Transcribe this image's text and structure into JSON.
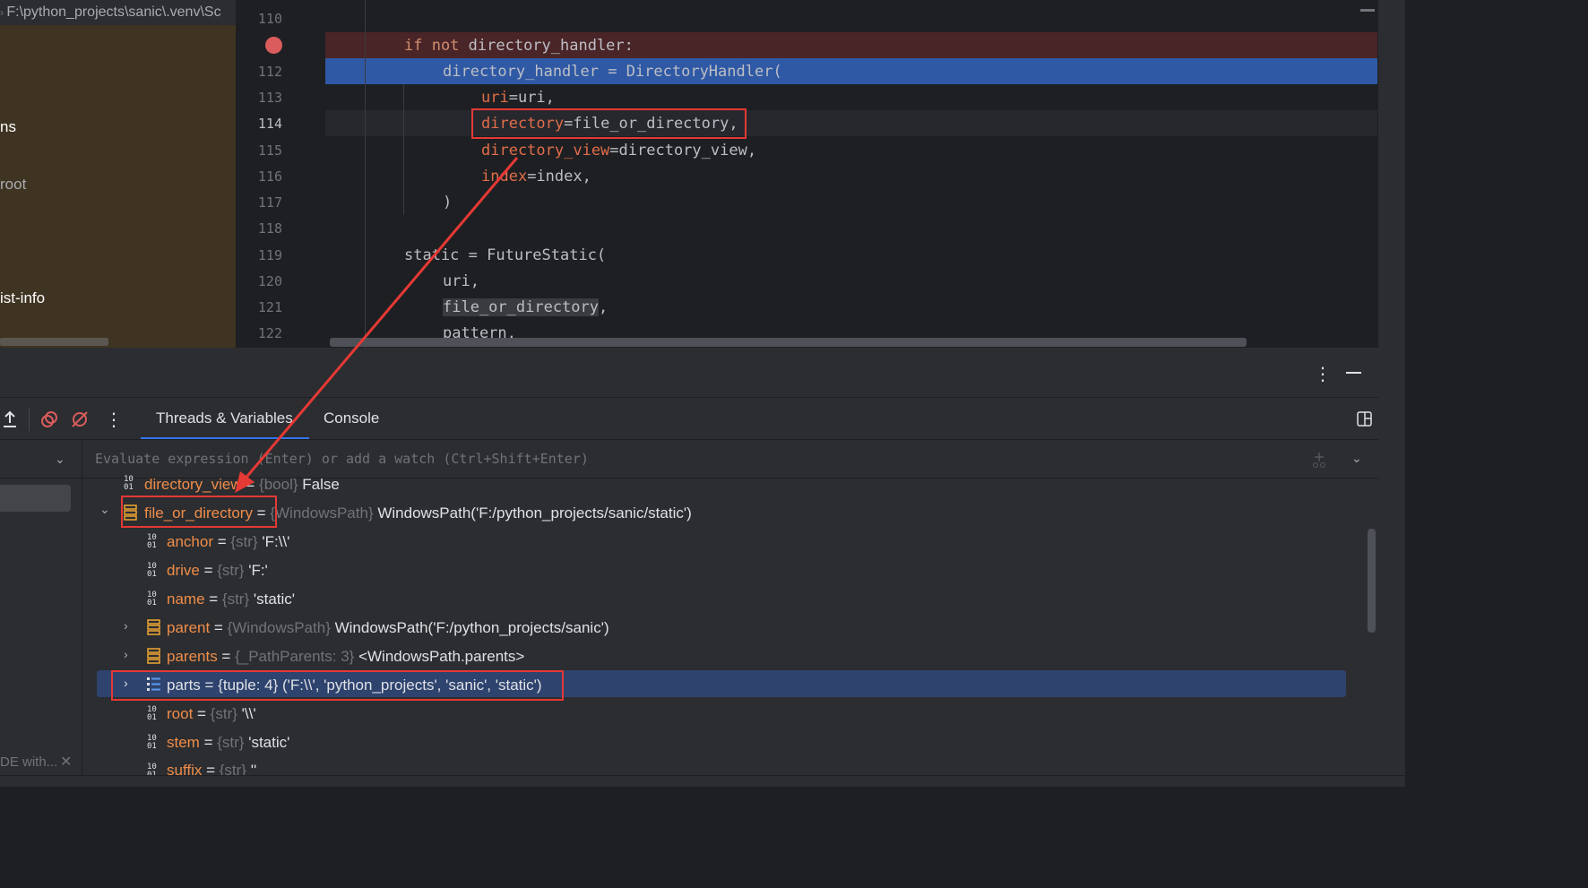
{
  "project": {
    "path": "F:\\python_projects\\sanic\\.venv\\Sc",
    "items": [
      "ns",
      "root",
      "ist-info"
    ]
  },
  "editor": {
    "lines": [
      {
        "n": "110"
      },
      {
        "n": ""
      },
      {
        "n": "112"
      },
      {
        "n": "113"
      },
      {
        "n": "114"
      },
      {
        "n": "115"
      },
      {
        "n": "116"
      },
      {
        "n": "117"
      },
      {
        "n": "118"
      },
      {
        "n": "119"
      },
      {
        "n": "120"
      },
      {
        "n": "121"
      },
      {
        "n": "122"
      }
    ],
    "code": {
      "l111_kw": "if not",
      "l111_rest": " directory_handler:",
      "l112": "directory_handler = DirectoryHandler(",
      "l113_p": "uri",
      "l113_v": "=uri,",
      "l114_p": "directory",
      "l114_v": "=file_or_directory,",
      "l115_p": "directory_view",
      "l115_v": "=directory_view,",
      "l116_p": "index",
      "l116_v": "=index,",
      "l117": ")",
      "l119": "static = FutureStatic(",
      "l120": "uri,",
      "l121_a": "file_or_directory",
      "l121_b": ",",
      "l122": "pattern,"
    }
  },
  "debug": {
    "tabs": [
      "Threads & Variables",
      "Console"
    ],
    "eval_placeholder": "Evaluate expression (Enter) or add a watch (Ctrl+Shift+Enter)",
    "frame_footer": "DE with...",
    "variables": [
      {
        "name": "directory_view",
        "eq": " = ",
        "type": "{bool}",
        "value": " False"
      },
      {
        "name": "file_or_directory",
        "eq": " = ",
        "type": "{WindowsPath}",
        "value": " WindowsPath('F:/python_projects/sanic/static')"
      },
      {
        "name": "anchor",
        "eq": " = ",
        "type": "{str}",
        "value": " 'F:\\\\'"
      },
      {
        "name": "drive",
        "eq": " = ",
        "type": "{str}",
        "value": " 'F:'"
      },
      {
        "name": "name",
        "eq": " = ",
        "type": "{str}",
        "value": " 'static'"
      },
      {
        "name": "parent",
        "eq": " = ",
        "type": "{WindowsPath}",
        "value": " WindowsPath('F:/python_projects/sanic')"
      },
      {
        "name": "parents",
        "eq": " = ",
        "type": "{_PathParents: 3}",
        "value": " <WindowsPath.parents>"
      },
      {
        "name": "parts",
        "eq": " = ",
        "type": "{tuple: 4}",
        "value": " ('F:\\\\', 'python_projects', 'sanic', 'static')"
      },
      {
        "name": "root",
        "eq": " = ",
        "type": "{str}",
        "value": " '\\\\'"
      },
      {
        "name": "stem",
        "eq": " = ",
        "type": "{str}",
        "value": " 'static'"
      },
      {
        "name": "suffix",
        "eq": " = ",
        "type": "{str}",
        "value": " ''"
      }
    ]
  },
  "colors": {
    "breakpoint_line": "#4a2528",
    "execution_line": "#2f59a5",
    "annotation": "#e53935",
    "selection": "#2e436e"
  }
}
